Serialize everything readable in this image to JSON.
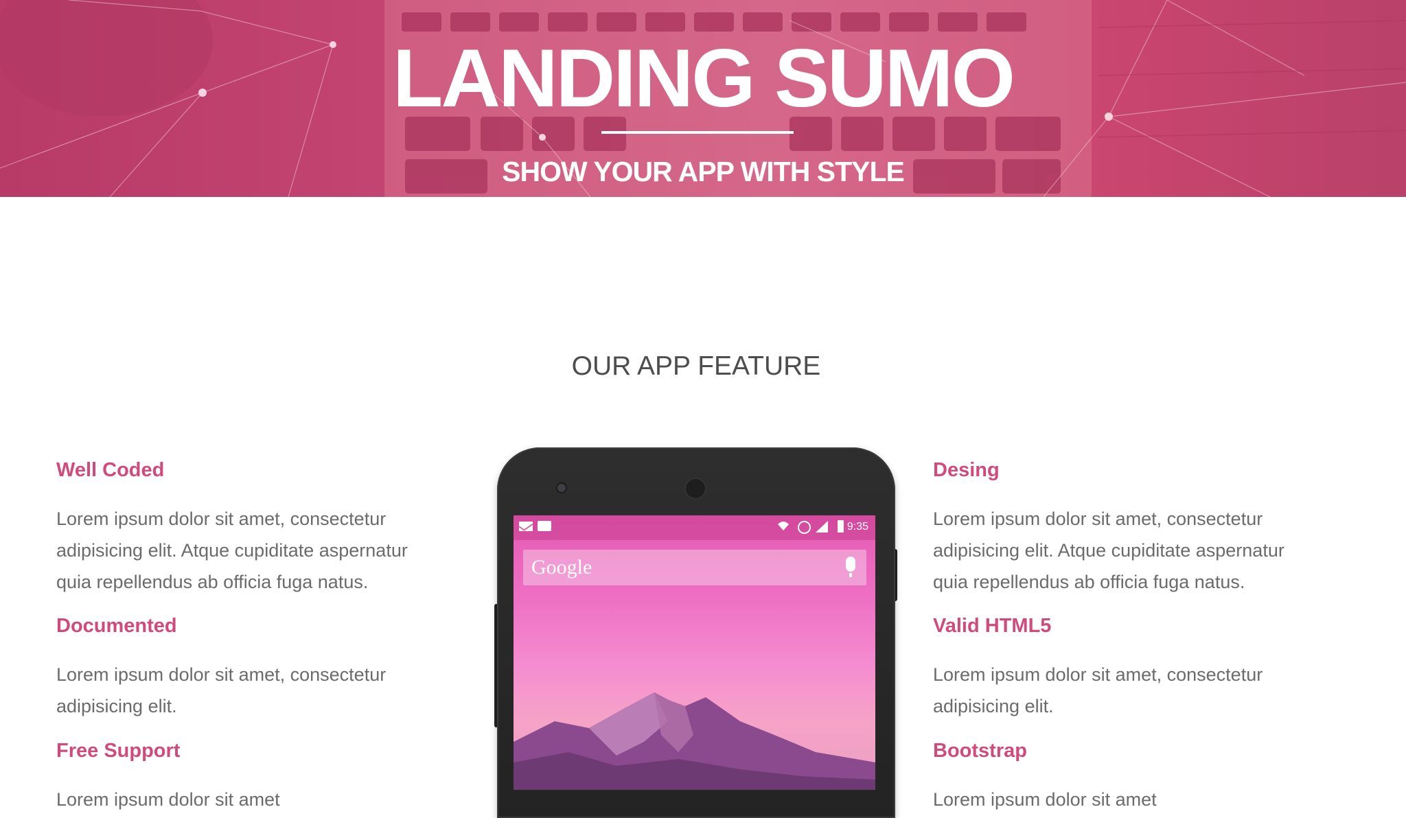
{
  "hero": {
    "title": "LANDING SUMO",
    "subtitle": "SHOW YOUR APP WITH STYLE"
  },
  "features": {
    "heading": "OUR APP FEATURE",
    "left": [
      {
        "title": "Well Coded",
        "text": "Lorem ipsum dolor sit amet, consectetur adipisicing elit. Atque cupiditate aspernatur quia repellendus ab officia fuga natus."
      },
      {
        "title": "Documented",
        "text": "Lorem ipsum dolor sit amet, consectetur adipisicing elit."
      },
      {
        "title": "Free Support",
        "text": "Lorem ipsum dolor sit amet"
      }
    ],
    "right": [
      {
        "title": "Desing",
        "text": "Lorem ipsum dolor sit amet, consectetur adipisicing elit. Atque cupiditate aspernatur quia repellendus ab officia fuga natus."
      },
      {
        "title": "Valid HTML5",
        "text": "Lorem ipsum dolor sit amet, consectetur adipisicing elit."
      },
      {
        "title": "Bootstrap",
        "text": "Lorem ipsum dolor sit amet"
      }
    ]
  },
  "phone": {
    "status_time": "9:35",
    "search_label": "Google",
    "status_icons": [
      "mail-icon",
      "chat-icon",
      "wifi-icon",
      "alarm-icon",
      "signal-icon",
      "battery-icon"
    ]
  },
  "colors": {
    "hero_overlay": "#c44571",
    "accent": "#d04b7b",
    "heading": "#4d4d4d",
    "body_text": "#6b6b6b"
  }
}
